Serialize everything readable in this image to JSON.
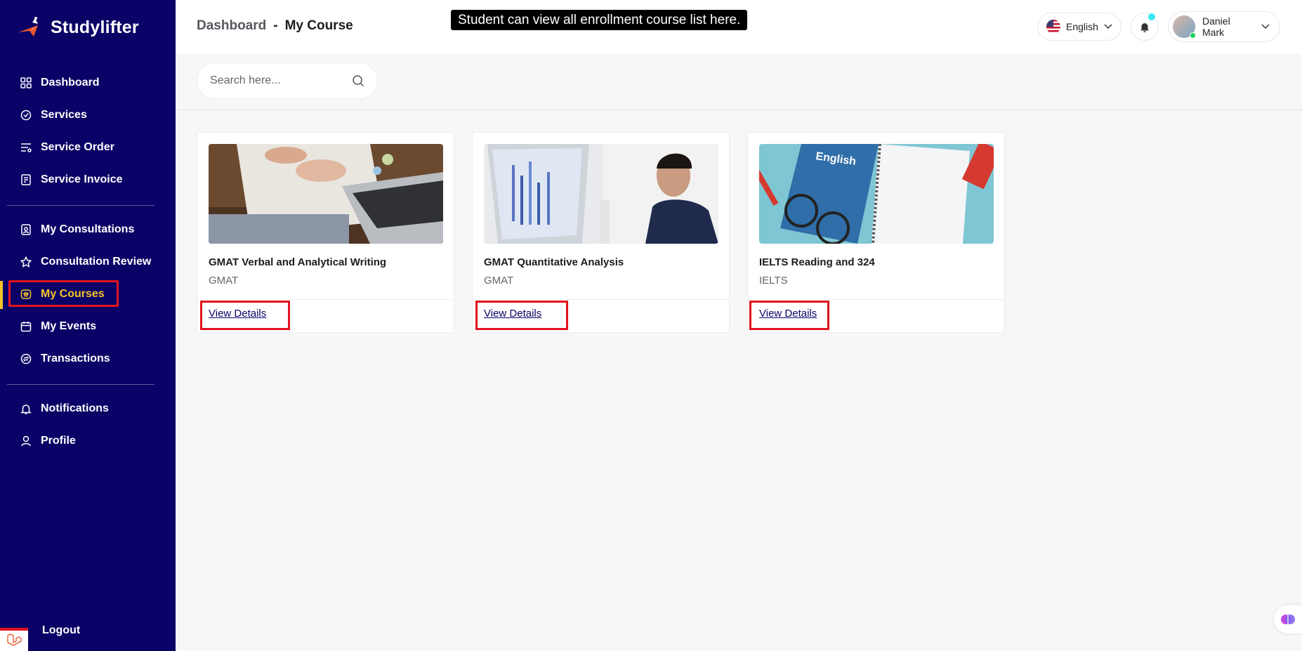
{
  "sidebar": {
    "brand": "Studylifter",
    "groups": [
      [
        {
          "label": "Dashboard",
          "icon": "dashboard-icon"
        },
        {
          "label": "Services",
          "icon": "services-icon"
        },
        {
          "label": "Service Order",
          "icon": "service-order-icon"
        },
        {
          "label": "Service Invoice",
          "icon": "invoice-icon"
        }
      ],
      [
        {
          "label": "My Consultations",
          "icon": "consultation-icon"
        },
        {
          "label": "Consultation Review",
          "icon": "star-icon"
        },
        {
          "label": "My Courses",
          "icon": "courses-icon",
          "active": true
        },
        {
          "label": "My Events",
          "icon": "calendar-icon"
        },
        {
          "label": "Transactions",
          "icon": "transactions-icon"
        }
      ],
      [
        {
          "label": "Notifications",
          "icon": "bell-icon"
        },
        {
          "label": "Profile",
          "icon": "user-icon"
        }
      ]
    ],
    "logout_label": "Logout",
    "active_color": "#f6c327",
    "bg_color": "#0a0266"
  },
  "header": {
    "breadcrumb_root": "Dashboard",
    "breadcrumb_sep": "-",
    "breadcrumb_current": "My Course",
    "tooltip": "Student can view all enrollment course list here.",
    "language": "English",
    "user_name": "Daniel Mark"
  },
  "search": {
    "placeholder": "Search here..."
  },
  "courses": [
    {
      "title": "GMAT Verbal and Analytical Writing",
      "category": "GMAT",
      "link": "View Details"
    },
    {
      "title": "GMAT Quantitative Analysis",
      "category": "GMAT",
      "link": "View Details"
    },
    {
      "title": "IELTS Reading and 324",
      "category": "IELTS",
      "link": "View Details"
    }
  ],
  "highlight_color": "#e0141e"
}
